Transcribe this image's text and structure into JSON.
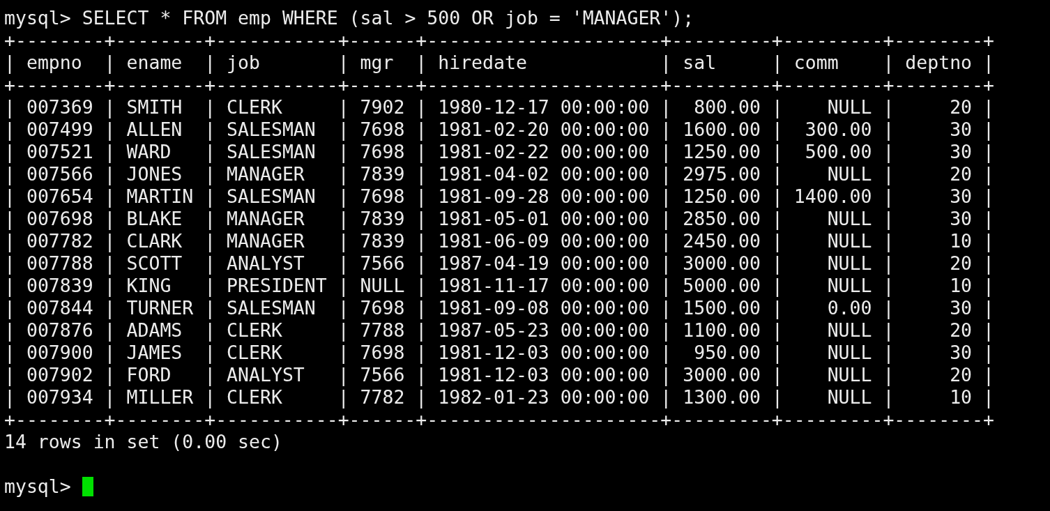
{
  "command": {
    "prompt": "mysql>",
    "text": "SELECT * FROM emp WHERE (sal > 500 OR job = 'MANAGER');"
  },
  "table": {
    "border": "+--------+--------+-----------+------+---------------------+---------+---------+--------+",
    "separator": "|",
    "columns": [
      {
        "name": "empno"
      },
      {
        "name": "ename",
        "numeric": false
      },
      {
        "name": "job",
        "numeric": false
      },
      {
        "name": "mgr"
      },
      {
        "name": "hiredate"
      },
      {
        "name": "sal",
        "numeric": true
      },
      {
        "name": "comm",
        "numeric": true
      },
      {
        "name": "deptno",
        "numeric": true
      }
    ],
    "rows": [
      [
        "007369",
        "SMITH",
        "CLERK",
        "7902",
        "1980-12-17 00:00:00",
        "800.00",
        "NULL",
        "20"
      ],
      [
        "007499",
        "ALLEN",
        "SALESMAN",
        "7698",
        "1981-02-20 00:00:00",
        "1600.00",
        "300.00",
        "30"
      ],
      [
        "007521",
        "WARD",
        "SALESMAN",
        "7698",
        "1981-02-22 00:00:00",
        "1250.00",
        "500.00",
        "30"
      ],
      [
        "007566",
        "JONES",
        "MANAGER",
        "7839",
        "1981-04-02 00:00:00",
        "2975.00",
        "NULL",
        "20"
      ],
      [
        "007654",
        "MARTIN",
        "SALESMAN",
        "7698",
        "1981-09-28 00:00:00",
        "1250.00",
        "1400.00",
        "30"
      ],
      [
        "007698",
        "BLAKE",
        "MANAGER",
        "7839",
        "1981-05-01 00:00:00",
        "2850.00",
        "NULL",
        "30"
      ],
      [
        "007782",
        "CLARK",
        "MANAGER",
        "7839",
        "1981-06-09 00:00:00",
        "2450.00",
        "NULL",
        "10"
      ],
      [
        "007788",
        "SCOTT",
        "ANALYST",
        "7566",
        "1987-04-19 00:00:00",
        "3000.00",
        "NULL",
        "20"
      ],
      [
        "007839",
        "KING",
        "PRESIDENT",
        "NULL",
        "1981-11-17 00:00:00",
        "5000.00",
        "NULL",
        "10"
      ],
      [
        "007844",
        "TURNER",
        "SALESMAN",
        "7698",
        "1981-09-08 00:00:00",
        "1500.00",
        "0.00",
        "30"
      ],
      [
        "007876",
        "ADAMS",
        "CLERK",
        "7788",
        "1987-05-23 00:00:00",
        "1100.00",
        "NULL",
        "20"
      ],
      [
        "007900",
        "JAMES",
        "CLERK",
        "7698",
        "1981-12-03 00:00:00",
        "950.00",
        "NULL",
        "30"
      ],
      [
        "007902",
        "FORD",
        "ANALYST",
        "7566",
        "1981-12-03 00:00:00",
        "3000.00",
        "NULL",
        "20"
      ],
      [
        "007934",
        "MILLER",
        "CLERK",
        "7782",
        "1982-01-23 00:00:00",
        "1300.00",
        "NULL",
        "10"
      ]
    ]
  },
  "result": "14 rows in set (0.00 sec)",
  "prompt": "mysql>"
}
